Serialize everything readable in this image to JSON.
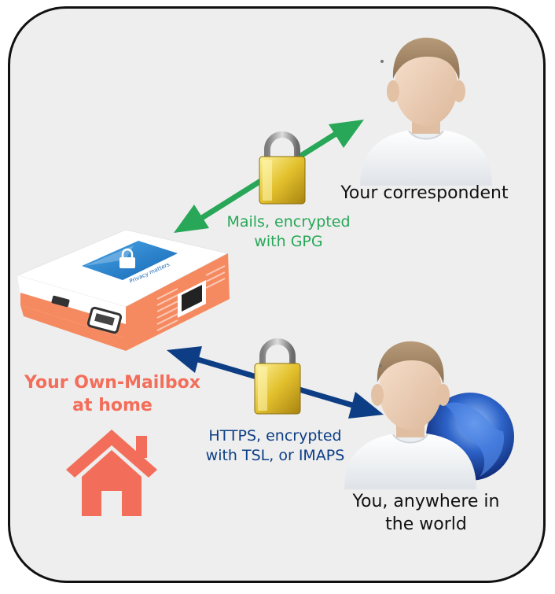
{
  "colors": {
    "green": "#27a757",
    "blue": "#0d3e85",
    "coral": "#f36e5a",
    "device_orange": "#f58a61",
    "frame_bg": "#eeeeee"
  },
  "correspondent": {
    "label": "Your correspondent"
  },
  "green_channel": {
    "line1": "Mails, encrypted",
    "line2": "with GPG"
  },
  "mailbox": {
    "line1": "Your Own-Mailbox",
    "line2": "at home",
    "device_badge": "Privacy matters"
  },
  "blue_channel": {
    "line1": "HTTPS, encrypted",
    "line2": "with TSL, or IMAPS"
  },
  "you": {
    "line1": "You, anywhere in",
    "line2": "the world"
  },
  "icons": [
    "padlock-icon",
    "padlock-icon",
    "house-icon",
    "globe-icon",
    "person-icon",
    "person-icon",
    "mailbox-device-icon"
  ]
}
